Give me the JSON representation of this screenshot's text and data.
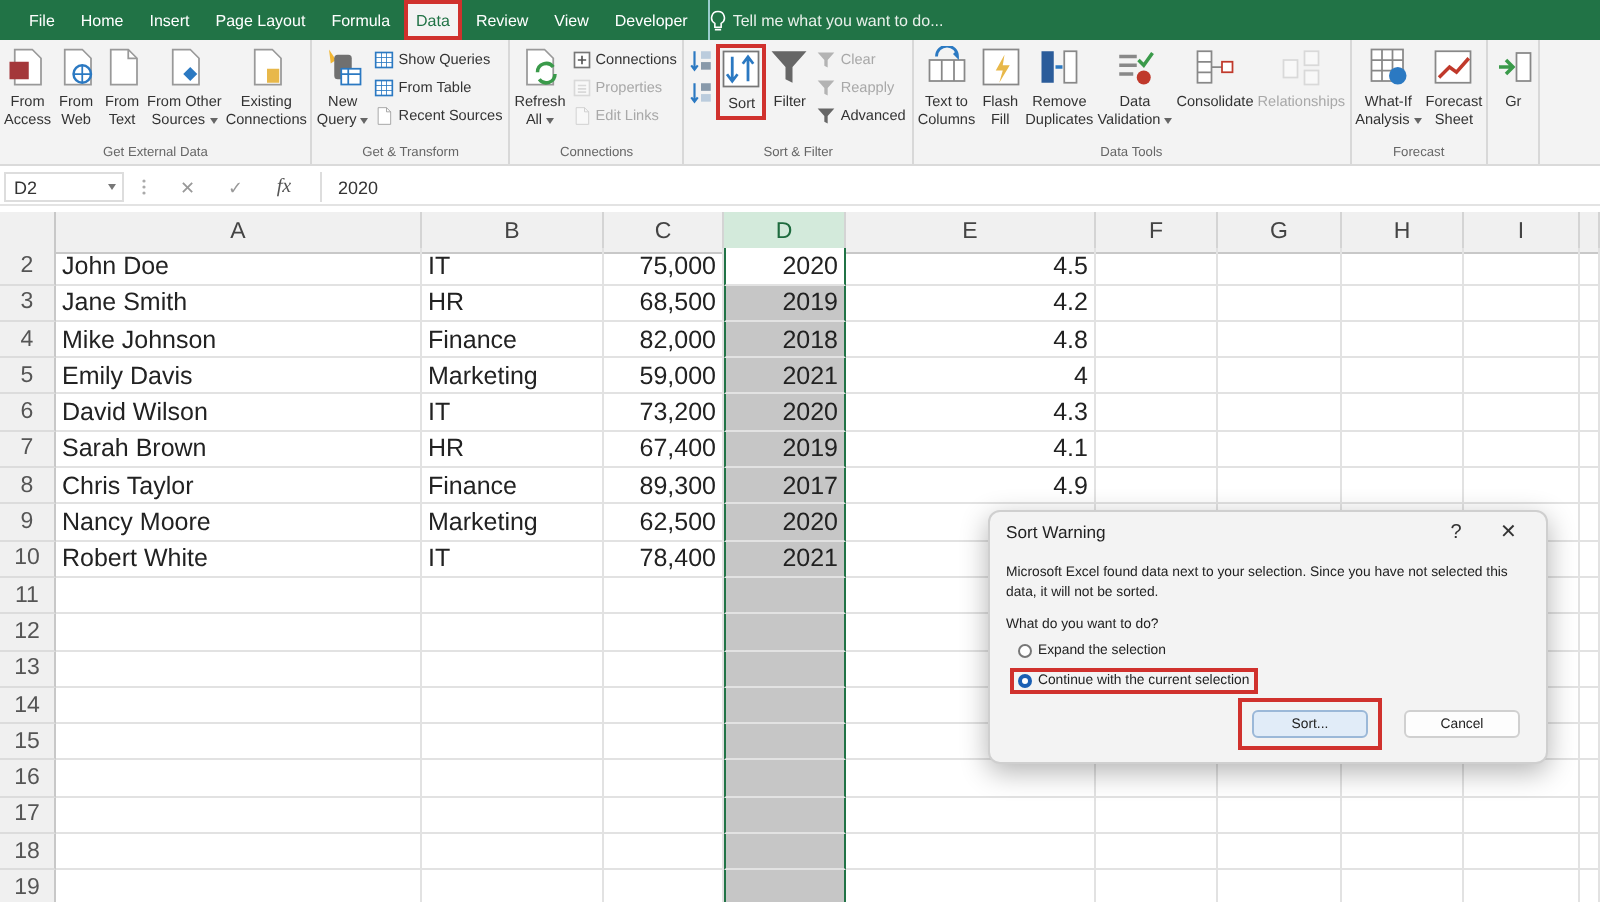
{
  "tabs": [
    {
      "label": "File",
      "selected": false,
      "highlighted": false
    },
    {
      "label": "Home",
      "selected": false,
      "highlighted": false
    },
    {
      "label": "Insert",
      "selected": false,
      "highlighted": false
    },
    {
      "label": "Page Layout",
      "selected": false,
      "highlighted": false
    },
    {
      "label": "Formula",
      "selected": false,
      "highlighted": false
    },
    {
      "label": "Data",
      "selected": true,
      "highlighted": true
    },
    {
      "label": "Review",
      "selected": false,
      "highlighted": false
    },
    {
      "label": "View",
      "selected": false,
      "highlighted": false
    },
    {
      "label": "Developer",
      "selected": false,
      "highlighted": false
    }
  ],
  "tell_me": {
    "placeholder": "Tell me what you want to do..."
  },
  "ribbon_groups": [
    {
      "label": "Get External Data",
      "items": [
        {
          "kind": "large",
          "label": "From\nAccess",
          "disabled": false,
          "dropdown": false,
          "highlighted": false
        },
        {
          "kind": "large",
          "label": "From\nWeb",
          "disabled": false,
          "dropdown": false,
          "highlighted": false
        },
        {
          "kind": "large",
          "label": "From\nText",
          "disabled": false,
          "dropdown": false,
          "highlighted": false
        },
        {
          "kind": "large",
          "label": "From Other\nSources",
          "disabled": false,
          "dropdown": true,
          "highlighted": false
        },
        {
          "kind": "large",
          "label": "Existing\nConnections",
          "disabled": false,
          "dropdown": false,
          "highlighted": false
        }
      ]
    },
    {
      "label": "Get & Transform",
      "items": [
        {
          "kind": "large",
          "label": "New\nQuery",
          "disabled": false,
          "dropdown": true,
          "highlighted": false
        },
        {
          "kind": "small",
          "label": "Show Queries",
          "disabled": false,
          "dropdown": false,
          "highlighted": false
        },
        {
          "kind": "small",
          "label": "From Table",
          "disabled": false,
          "dropdown": false,
          "highlighted": false
        },
        {
          "kind": "small",
          "label": "Recent Sources",
          "disabled": false,
          "dropdown": false,
          "highlighted": false
        }
      ]
    },
    {
      "label": "Connections",
      "items": [
        {
          "kind": "large",
          "label": "Refresh\nAll",
          "disabled": false,
          "dropdown": true,
          "highlighted": false
        },
        {
          "kind": "small",
          "label": "Connections",
          "disabled": false,
          "dropdown": false,
          "highlighted": false
        },
        {
          "kind": "small",
          "label": "Properties",
          "disabled": true,
          "dropdown": false,
          "highlighted": false
        },
        {
          "kind": "small",
          "label": "Edit Links",
          "disabled": true,
          "dropdown": false,
          "highlighted": false
        }
      ]
    },
    {
      "label": "Sort & Filter",
      "items": [
        {
          "kind": "icon",
          "disabled": false,
          "highlighted": false
        },
        {
          "kind": "icon",
          "disabled": false,
          "highlighted": false
        },
        {
          "kind": "large",
          "label": "Sort",
          "disabled": false,
          "dropdown": false,
          "highlighted": true
        },
        {
          "kind": "large",
          "label": "Filter",
          "disabled": false,
          "dropdown": false,
          "highlighted": false
        },
        {
          "kind": "small",
          "label": "Clear",
          "disabled": true,
          "dropdown": false,
          "highlighted": false
        },
        {
          "kind": "small",
          "label": "Reapply",
          "disabled": true,
          "dropdown": false,
          "highlighted": false
        },
        {
          "kind": "small",
          "label": "Advanced",
          "disabled": false,
          "dropdown": false,
          "highlighted": false
        }
      ]
    },
    {
      "label": "Data Tools",
      "items": [
        {
          "kind": "large",
          "label": "Text to\nColumns",
          "disabled": false,
          "dropdown": false,
          "highlighted": false
        },
        {
          "kind": "large",
          "label": "Flash\nFill",
          "disabled": false,
          "dropdown": false,
          "highlighted": false
        },
        {
          "kind": "large",
          "label": "Remove\nDuplicates",
          "disabled": false,
          "dropdown": false,
          "highlighted": false
        },
        {
          "kind": "large",
          "label": "Data\nValidation",
          "disabled": false,
          "dropdown": true,
          "highlighted": false
        },
        {
          "kind": "large",
          "label": "Consolidate",
          "disabled": false,
          "dropdown": false,
          "highlighted": false
        },
        {
          "kind": "large",
          "label": "Relationships",
          "disabled": true,
          "dropdown": false,
          "highlighted": false
        }
      ]
    },
    {
      "label": "Forecast",
      "items": [
        {
          "kind": "large",
          "label": "What-If\nAnalysis",
          "disabled": false,
          "dropdown": true,
          "highlighted": false
        },
        {
          "kind": "large",
          "label": "Forecast\nSheet",
          "disabled": false,
          "dropdown": false,
          "highlighted": false
        }
      ]
    },
    {
      "items": [
        {
          "kind": "large",
          "label": "Gr",
          "disabled": false,
          "dropdown": false,
          "highlighted": false
        }
      ]
    }
  ],
  "formula_bar": {
    "name_box": "D2",
    "cancel": "✕",
    "enter": "✓",
    "function": "fx",
    "value": "2020"
  },
  "sheet": {
    "columns": [
      {
        "label": "A",
        "kind": "text",
        "selected": false
      },
      {
        "label": "B",
        "kind": "text",
        "selected": false
      },
      {
        "label": "C",
        "kind": "number",
        "selected": false
      },
      {
        "label": "D",
        "kind": "number",
        "selected": true
      },
      {
        "label": "E",
        "kind": "number",
        "selected": false
      },
      {
        "label": "F",
        "kind": "text",
        "selected": false
      },
      {
        "label": "G",
        "kind": "text",
        "selected": false
      },
      {
        "label": "H",
        "kind": "text",
        "selected": false
      },
      {
        "label": "I",
        "kind": "text",
        "selected": false
      }
    ],
    "rows": [
      {
        "number": "2",
        "active": true,
        "cells": [
          "John Doe",
          "IT",
          "75,000",
          "2020",
          "4.5"
        ]
      },
      {
        "number": "3",
        "active": false,
        "cells": [
          "Jane Smith",
          "HR",
          "68,500",
          "2019",
          "4.2"
        ]
      },
      {
        "number": "4",
        "active": false,
        "cells": [
          "Mike Johnson",
          "Finance",
          "82,000",
          "2018",
          "4.8"
        ]
      },
      {
        "number": "5",
        "active": false,
        "cells": [
          "Emily Davis",
          "Marketing",
          "59,000",
          "2021",
          "4"
        ]
      },
      {
        "number": "6",
        "active": false,
        "cells": [
          "David Wilson",
          "IT",
          "73,200",
          "2020",
          "4.3"
        ]
      },
      {
        "number": "7",
        "active": false,
        "cells": [
          "Sarah Brown",
          "HR",
          "67,400",
          "2019",
          "4.1"
        ]
      },
      {
        "number": "8",
        "active": false,
        "cells": [
          "Chris Taylor",
          "Finance",
          "89,300",
          "2017",
          "4.9"
        ]
      },
      {
        "number": "9",
        "active": false,
        "cells": [
          "Nancy Moore",
          "Marketing",
          "62,500",
          "2020"
        ]
      },
      {
        "number": "10",
        "active": false,
        "cells": [
          "Robert White",
          "IT",
          "78,400",
          "2021"
        ]
      },
      {
        "number": "11",
        "active": false,
        "cells": []
      },
      {
        "number": "12",
        "active": false,
        "cells": []
      },
      {
        "number": "13",
        "active": false,
        "cells": []
      },
      {
        "number": "14",
        "active": false,
        "cells": []
      },
      {
        "number": "15",
        "active": false,
        "cells": []
      },
      {
        "number": "16",
        "active": false,
        "cells": []
      },
      {
        "number": "17",
        "active": false,
        "cells": []
      },
      {
        "number": "18",
        "active": false,
        "cells": []
      },
      {
        "number": "19",
        "active": false,
        "cells": []
      }
    ]
  },
  "dialog": {
    "title": "Sort Warning",
    "help": "?",
    "close": "✕",
    "message": "Microsoft Excel found data next to your selection.  Since you have not selected this data, it will not be sorted.",
    "question": "What do you want to do?",
    "options": [
      {
        "label": "Expand the selection",
        "selected": false,
        "highlighted": false
      },
      {
        "label": "Continue with the current selection",
        "selected": true,
        "highlighted": true
      }
    ],
    "buttons": [
      {
        "label": "Sort...",
        "focused": true,
        "highlighted": true
      },
      {
        "label": "Cancel",
        "focused": false,
        "highlighted": false
      }
    ]
  }
}
